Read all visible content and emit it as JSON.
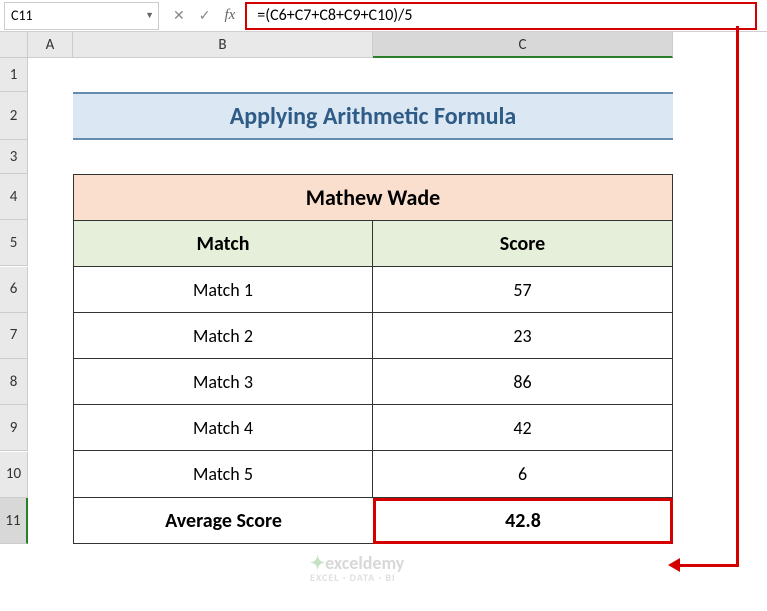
{
  "name_box": "C11",
  "formula": "=(C6+C7+C8+C9+C10)/5",
  "columns": [
    "A",
    "B",
    "C"
  ],
  "rows": [
    "1",
    "2",
    "3",
    "4",
    "5",
    "6",
    "7",
    "8",
    "9",
    "10",
    "11"
  ],
  "title": "Applying Arithmetic Formula",
  "player_name": "Mathew Wade",
  "headers": {
    "match": "Match",
    "score": "Score"
  },
  "avg_label": "Average Score",
  "avg_value": "42.8",
  "watermark": {
    "brand": "exceldemy",
    "sub": "EXCEL · DATA · BI"
  },
  "chart_data": {
    "type": "table",
    "title": "Mathew Wade",
    "columns": [
      "Match",
      "Score"
    ],
    "rows": [
      [
        "Match 1",
        57
      ],
      [
        "Match 2",
        23
      ],
      [
        "Match 3",
        86
      ],
      [
        "Match 4",
        42
      ],
      [
        "Match 5",
        6
      ]
    ],
    "summary": {
      "label": "Average Score",
      "value": 42.8
    }
  }
}
